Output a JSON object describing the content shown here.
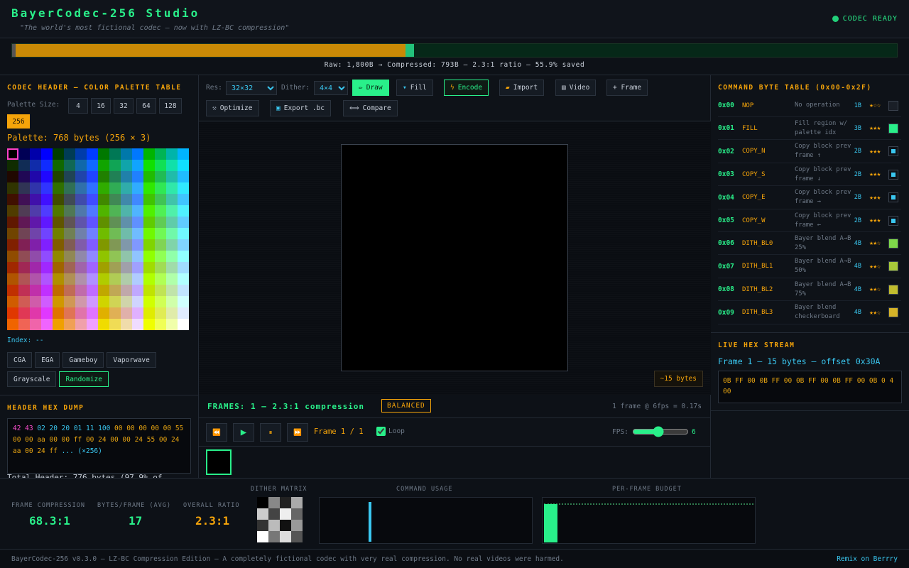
{
  "header": {
    "title": "BayerCodec-256 Studio",
    "tagline": "\"The world's most fictional codec — now with LZ-BC compression\"",
    "status": "CODEC READY"
  },
  "ratio_bar": {
    "compressed_fraction": 0.441,
    "text": "Raw: 1,800B → Compressed: 793B — 2.3:1 ratio — 55.9% saved"
  },
  "palette": {
    "title": "CODEC HEADER — COLOR PALETTE TABLE",
    "size_label": "Palette Size:",
    "sizes": [
      "4",
      "16",
      "32",
      "64",
      "128",
      "256"
    ],
    "selected_size": "256",
    "info": "Palette: 768 bytes (256 × 3)",
    "index_text": "Index: --",
    "presets": [
      "CGA",
      "EGA",
      "Gameboy",
      "Vaporwave",
      "Grayscale",
      "Randomize"
    ]
  },
  "hex_dump": {
    "title": "HEADER HEX DUMP",
    "magic": "42 43",
    "fields": "02 20 20 01 11 100",
    "palette_bytes": "00 00 00 00 00 55 00 00 aa 00 00 ff 00 24 00 00 24 55 00 24 aa 00 24 ff",
    "ellipsis": "... (×256)",
    "total_text": "Total Header: 776 bytes (97.9% of"
  },
  "toolbar": {
    "res_label": "Res:",
    "res_value": "32×32",
    "dither_label": "Dither:",
    "dither_value": "4×4",
    "draw": "Draw",
    "fill": "Fill",
    "encode": "Encode",
    "import": "Import",
    "video": "Video",
    "frame": "+ Frame",
    "optimize": "Optimize",
    "export": "Export .bc",
    "compare": "Compare"
  },
  "canvas": {
    "bytes_badge": "~15 bytes"
  },
  "frames": {
    "title": "FRAMES: 1 — 2.3:1 compression",
    "badge": "BALANCED",
    "info": "1 frame @ 6fps = 0.17s",
    "counter": "Frame 1 / 1",
    "loop_label": "Loop",
    "fps_label": "FPS:",
    "fps_value": "6"
  },
  "commands": {
    "title": "COMMAND BYTE TABLE (0x00-0x2F)",
    "rows": [
      {
        "code": "0x00",
        "name": "NOP",
        "desc": "No operation",
        "bytes": "1B",
        "stars": "★☆☆",
        "color": "#1a1f27",
        "inner": ""
      },
      {
        "code": "0x01",
        "name": "FILL",
        "desc": "Fill region w/ palette idx",
        "bytes": "3B",
        "stars": "★★★",
        "color": "#29f08a",
        "inner": ""
      },
      {
        "code": "0x02",
        "name": "COPY_N",
        "desc": "Copy block prev frame ↑",
        "bytes": "2B",
        "stars": "★★★",
        "color": "#0e1218",
        "inner": "#3ac7f0"
      },
      {
        "code": "0x03",
        "name": "COPY_S",
        "desc": "Copy block prev frame ↓",
        "bytes": "2B",
        "stars": "★★★",
        "color": "#0e1218",
        "inner": "#3ac7f0"
      },
      {
        "code": "0x04",
        "name": "COPY_E",
        "desc": "Copy block prev frame →",
        "bytes": "2B",
        "stars": "★★★",
        "color": "#0e1218",
        "inner": "#3ac7f0"
      },
      {
        "code": "0x05",
        "name": "COPY_W",
        "desc": "Copy block prev frame ←",
        "bytes": "2B",
        "stars": "★★★",
        "color": "#0e1218",
        "inner": "#3ac7f0"
      },
      {
        "code": "0x06",
        "name": "DITH_BL0",
        "desc": "Bayer blend A→B 25%",
        "bytes": "4B",
        "stars": "★★☆",
        "color": "#7fd84a",
        "inner": ""
      },
      {
        "code": "0x07",
        "name": "DITH_BL1",
        "desc": "Bayer blend A→B 50%",
        "bytes": "4B",
        "stars": "★★☆",
        "color": "#a8c93a",
        "inner": ""
      },
      {
        "code": "0x08",
        "name": "DITH_BL2",
        "desc": "Bayer blend A→B 75%",
        "bytes": "4B",
        "stars": "★★☆",
        "color": "#c2bd2e",
        "inner": ""
      },
      {
        "code": "0x09",
        "name": "DITH_BL3",
        "desc": "Bayer blend checkerboard",
        "bytes": "4B",
        "stars": "★★☆",
        "color": "#d6b428",
        "inner": ""
      }
    ]
  },
  "hex_stream": {
    "title": "LIVE HEX STREAM",
    "frame_info": "Frame 1 — 15 bytes — offset 0x30A",
    "bytes": "0B FF 00 0B FF 00 0B FF 00 0B FF 00 0B 0 4 00"
  },
  "stats": {
    "frame_compression_label": "FRAME COMPRESSION",
    "frame_compression_value": "68.3:1",
    "bytes_per_frame_label": "BYTES/FRAME (AVG)",
    "bytes_per_frame_value": "17",
    "overall_ratio_label": "OVERALL RATIO",
    "overall_ratio_value": "2.3:1",
    "dither_matrix_label": "DITHER MATRIX",
    "command_usage_label": "COMMAND USAGE",
    "budget_label": "PER-FRAME BUDGET",
    "budget_used_fraction": 0.03
  },
  "footer": {
    "text": "BayerCodec-256 v0.3.0 — LZ-BC Compression Edition — A completely fictional codec with very real compression. No real videos were harmed.",
    "link": "Remix on Berrry"
  }
}
